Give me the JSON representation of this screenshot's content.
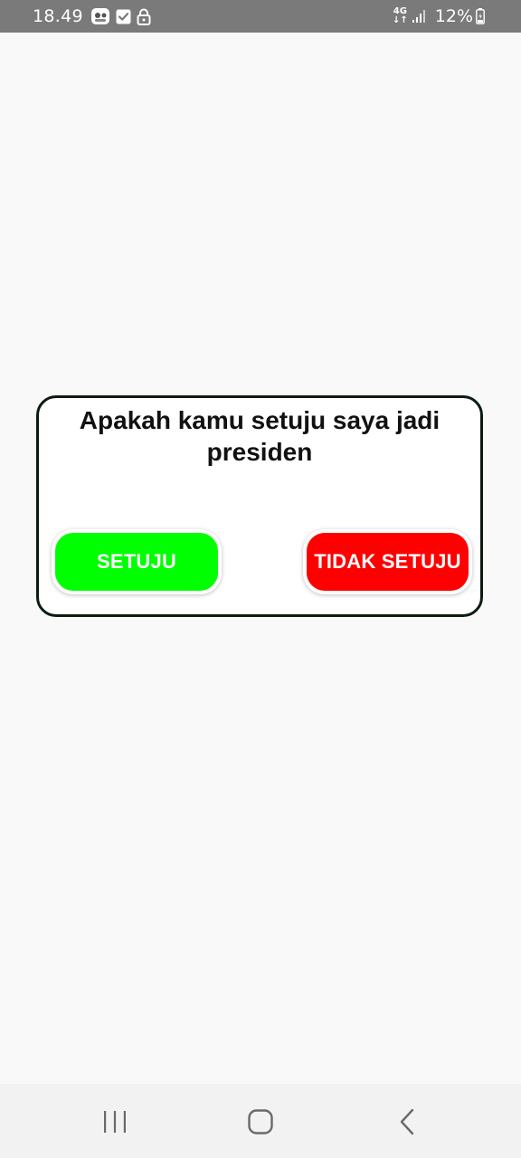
{
  "status_bar": {
    "time": "18.49",
    "network_label_top": "4G",
    "network_label_bottom": "↓↑",
    "battery_percent": "12%",
    "icons": [
      "photo-thumbnail-icon",
      "check-box-icon",
      "lock-icon",
      "signal-icon",
      "battery-icon"
    ]
  },
  "dialog": {
    "title": "Apakah kamu setuju saya jadi presiden",
    "agree_label": "SETUJU",
    "disagree_label": "TIDAK SETUJU"
  },
  "colors": {
    "agree_button": "#00ff00",
    "disagree_button": "#ff0000",
    "dialog_border": "#0c1c10",
    "status_bar": "#7a7a7a",
    "background": "#f9f9f9"
  },
  "nav_bar": {
    "buttons": [
      "recent-apps",
      "home",
      "back"
    ]
  }
}
